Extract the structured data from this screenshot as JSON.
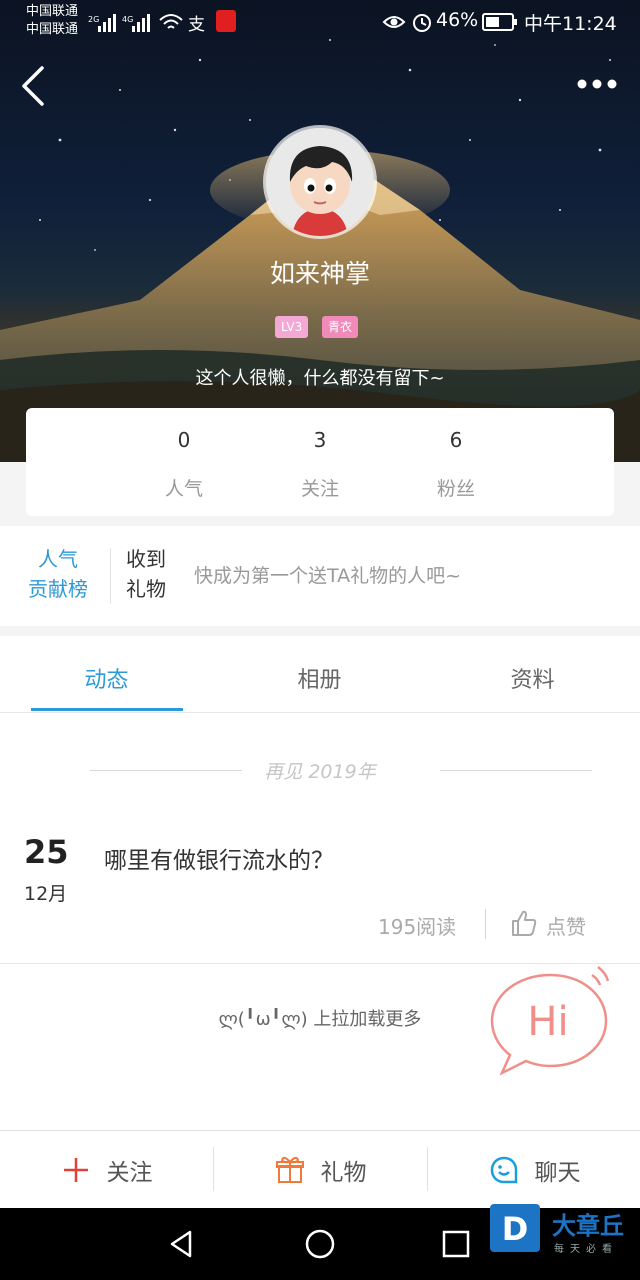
{
  "status_bar": {
    "carrier_1": "中国联通",
    "carrier_2": "中国联通",
    "battery": "46%",
    "time": "中午11:24"
  },
  "profile": {
    "nickname": "如来神掌",
    "level_badge": "LV3",
    "rank_badge": "青衣",
    "bio": "这个人很懒，什么都没有留下~",
    "stats": [
      {
        "value": "0",
        "label": "人气"
      },
      {
        "value": "3",
        "label": "关注"
      },
      {
        "value": "6",
        "label": "粉丝"
      }
    ]
  },
  "gifts": {
    "rank_label_line1": "人气",
    "rank_label_line2": "贡献榜",
    "received_line1": "收到",
    "received_line2": "礼物",
    "hint": "快成为第一个送TA礼物的人吧~"
  },
  "tabs": [
    {
      "label": "动态",
      "active": true
    },
    {
      "label": "相册",
      "active": false
    },
    {
      "label": "资料",
      "active": false
    }
  ],
  "feed": {
    "year_divider": "再见 2019年",
    "post": {
      "day": "25",
      "month": "12月",
      "title": "哪里有做银行流水的？",
      "reads": "195阅读",
      "like_label": "点赞"
    },
    "load_more": "ლ(╹ω╹ლ) 上拉加载更多",
    "hi_bubble": "Hi"
  },
  "actions": {
    "follow": "关注",
    "gift": "礼物",
    "chat": "聊天"
  },
  "watermark": {
    "title": "大章丘",
    "subtitle": "每天必看"
  },
  "colors": {
    "accent": "#2c9ad7",
    "follow_plus": "#e0403a",
    "gift_icon": "#f07a3a",
    "chat_icon": "#1aa0d8",
    "hi_bubble": "#f08f8a",
    "badge_level": "#f3a8d6",
    "badge_rank": "#f08ab8"
  }
}
